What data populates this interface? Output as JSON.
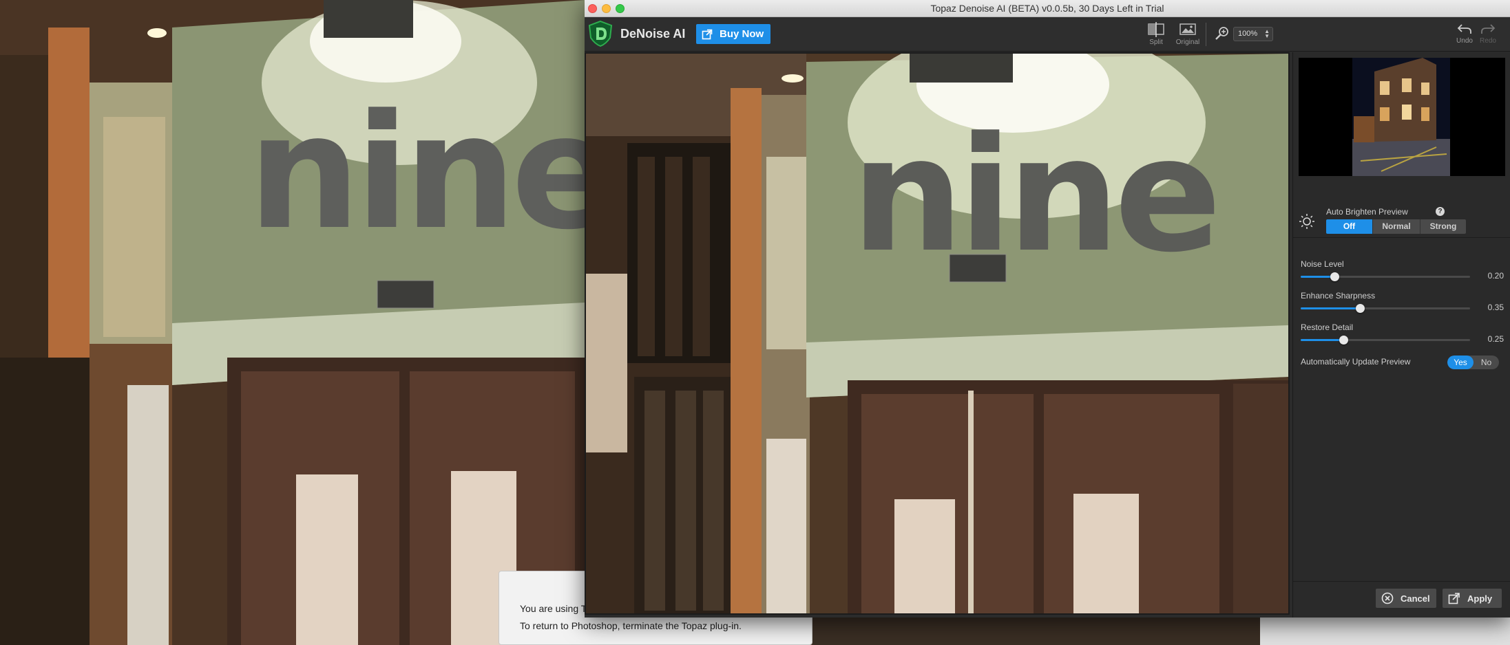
{
  "window": {
    "title": "Topaz Denoise AI (BETA) v0.0.5b, 30 Days Left in Trial"
  },
  "toolbar": {
    "app_name": "DeNoise AI",
    "buy_label": "Buy Now",
    "split_label": "Split",
    "original_label": "Original",
    "zoom_value": "100%",
    "undo_label": "Undo",
    "redo_label": "Redo"
  },
  "preview": {
    "sign_text": "nine"
  },
  "panel": {
    "brighten": {
      "label": "Auto Brighten Preview",
      "help": "?",
      "options": [
        "Off",
        "Normal",
        "Strong"
      ],
      "selected": "Off"
    },
    "sliders": [
      {
        "label": "Noise Level",
        "value": "0.20",
        "fraction": 0.2
      },
      {
        "label": "Enhance Sharpness",
        "value": "0.35",
        "fraction": 0.35
      },
      {
        "label": "Restore Detail",
        "value": "0.25",
        "fraction": 0.25
      }
    ],
    "auto_update": {
      "label": "Automatically Update Preview",
      "yes": "Yes",
      "no": "No",
      "selected": "Yes"
    },
    "cancel_label": "Cancel",
    "apply_label": "Apply"
  },
  "background_dialog": {
    "line1": "You are using T",
    "line2": "To return to Photoshop, terminate the Topaz plug-in."
  },
  "colors": {
    "accent": "#1e8fe8",
    "panel_bg": "#2a2a2a",
    "toolbar_bg": "#2e2e2e"
  },
  "icons": [
    "topaz-logo-icon",
    "external-link-icon",
    "split-view-icon",
    "original-view-icon",
    "zoom-icon",
    "undo-icon",
    "redo-icon",
    "sun-icon",
    "help-icon",
    "cancel-icon",
    "apply-icon"
  ]
}
